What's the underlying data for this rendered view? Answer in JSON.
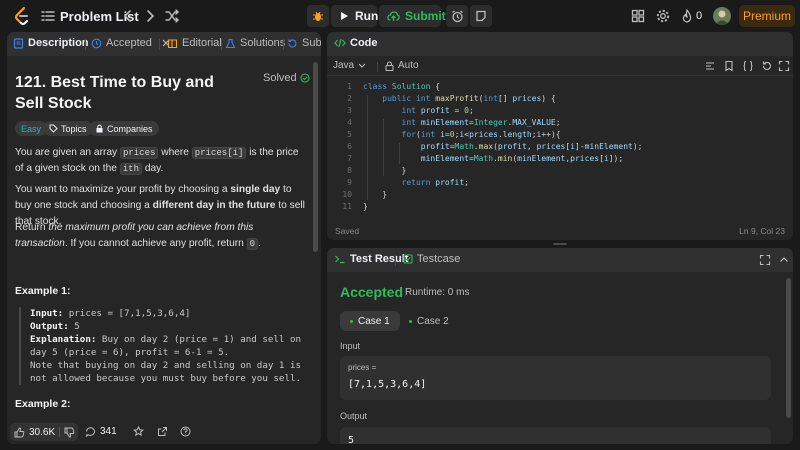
{
  "topbar": {
    "problem_list_label": "Problem List",
    "run_label": "Run",
    "submit_label": "Submit",
    "streak_count": "0",
    "premium_label": "Premium"
  },
  "left_tabs": {
    "description": "Description",
    "accepted": "Accepted",
    "editorial": "Editorial",
    "solutions": "Solutions",
    "submissions": "Subr"
  },
  "problem": {
    "title": "121. Best Time to Buy and Sell Stock",
    "status": "Solved",
    "difficulty": "Easy",
    "topics_label": "Topics",
    "companies_label": "Companies",
    "p1_a": "You are given an array ",
    "p1_code1": "prices",
    "p1_b": " where ",
    "p1_code2": "prices[i]",
    "p1_c": " is the price of a given stock on the ",
    "p1_code3": "ith",
    "p1_d": " day.",
    "p2_a": "You want to maximize your profit by choosing a ",
    "p2_b": "single day",
    "p2_c": " to buy one stock and choosing a ",
    "p2_d": "different day in the future",
    "p2_e": " to sell that stock.",
    "p3_a": "Return ",
    "p3_b": "the maximum profit you can achieve from this transaction",
    "p3_c": ". If you cannot achieve any profit, return ",
    "p3_code": "0",
    "p3_d": ".",
    "example1_title": "Example 1:",
    "example1_input_key": "Input:",
    "example1_input": " prices = [7,1,5,3,6,4]",
    "example1_output_key": "Output:",
    "example1_output": " 5",
    "example1_expl_key": "Explanation:",
    "example1_expl": " Buy on day 2 (price = 1) and sell on day 5 (price = 6), profit = 6-1 = 5.",
    "example1_note": "Note that buying on day 2 and selling on day 1 is not allowed because you must buy before you sell.",
    "example2_title": "Example 2:"
  },
  "footer": {
    "likes": "30.6K",
    "comments": "341"
  },
  "code_panel": {
    "title": "Code",
    "language": "Java",
    "autocomplete": "Auto",
    "saved": "Saved",
    "cursor": "Ln 9, Col 23"
  },
  "test_panel": {
    "title": "Test Result",
    "testcase_tab": "Testcase",
    "verdict": "Accepted",
    "runtime": "Runtime: 0 ms",
    "case1": "Case 1",
    "case2": "Case 2",
    "input_label": "Input",
    "input_var": "prices =",
    "input_value": "[7,1,5,3,6,4]",
    "output_label": "Output",
    "output_value": "5"
  },
  "colors": {
    "accent_green": "#2cbb5d",
    "premium_orange": "#ffa116",
    "background": "#1a1a1a",
    "panel": "#262626"
  }
}
